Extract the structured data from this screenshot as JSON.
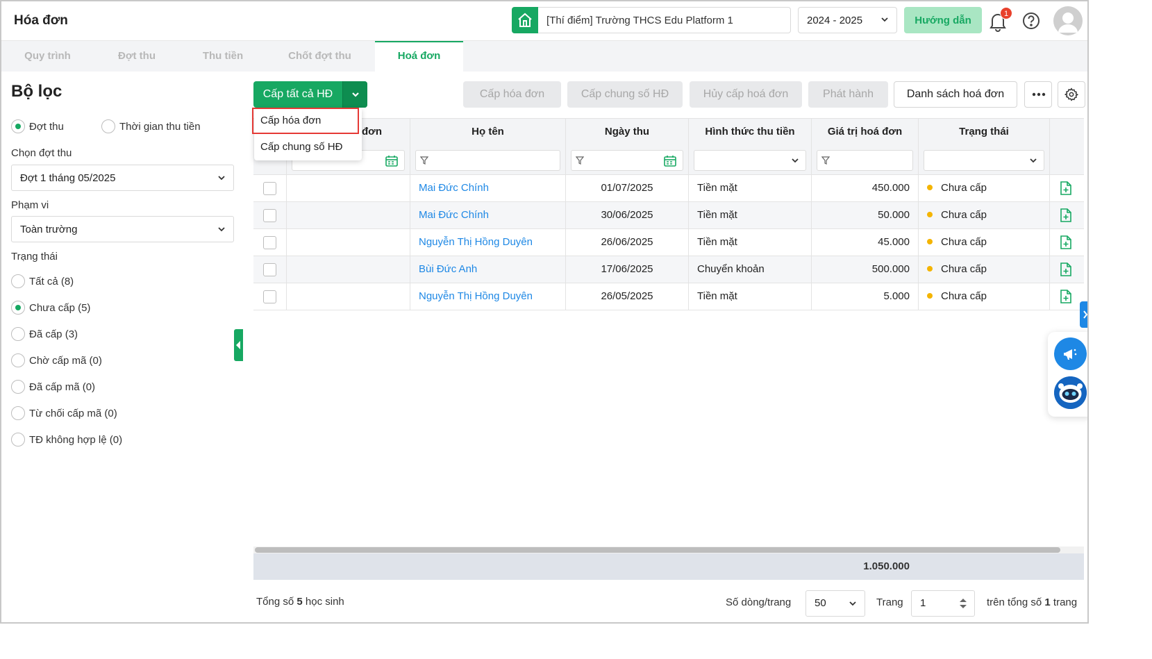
{
  "header": {
    "title": "Hóa đơn",
    "school": "[Thí điểm] Trường THCS Edu Platform 1",
    "school_year": "2024 - 2025",
    "guide_label": "Hướng dẫn",
    "notification_count": "1"
  },
  "tabs": [
    {
      "label": "Quy trình"
    },
    {
      "label": "Đợt thu"
    },
    {
      "label": "Thu tiền"
    },
    {
      "label": "Chốt đợt thu"
    },
    {
      "label": "Hoá đơn"
    }
  ],
  "filter": {
    "title": "Bộ lọc",
    "mode_options": [
      "Đợt thu",
      "Thời gian thu tiền"
    ],
    "period_label": "Chọn đợt thu",
    "period_value": "Đợt 1 tháng 05/2025",
    "scope_label": "Phạm vi",
    "scope_value": "Toàn trường",
    "status_label": "Trạng thái",
    "status_options": [
      "Tất cả (8)",
      "Chưa cấp (5)",
      "Đã cấp (3)",
      "Chờ cấp mã (0)",
      "Đã cấp mã (0)",
      "Từ chối cấp mã (0)",
      "TĐ không hợp lệ (0)"
    ]
  },
  "toolbar": {
    "issue_all": "Cấp tất cả HĐ",
    "issue_invoice": "Cấp hóa đơn",
    "issue_common_number": "Cấp chung số HĐ",
    "cancel_issue": "Hủy cấp hoá đơn",
    "publish": "Phát hành",
    "invoice_list": "Danh sách hoá đơn"
  },
  "dropdown_menu": {
    "items": [
      "Cấp hóa đơn",
      "Cấp chung số HĐ"
    ]
  },
  "table": {
    "columns": [
      "đơn",
      "Họ tên",
      "Ngày thu",
      "Hình thức thu tiền",
      "Giá trị hoá đơn",
      "Trạng thái"
    ],
    "rows": [
      {
        "name": "Mai Đức Chính",
        "date": "01/07/2025",
        "method": "Tiền mặt",
        "amount": "450.000",
        "status": "Chưa cấp"
      },
      {
        "name": "Mai Đức Chính",
        "date": "30/06/2025",
        "method": "Tiền mặt",
        "amount": "50.000",
        "status": "Chưa cấp"
      },
      {
        "name": "Nguyễn Thị Hồng Duyên",
        "date": "26/06/2025",
        "method": "Tiền mặt",
        "amount": "45.000",
        "status": "Chưa cấp"
      },
      {
        "name": "Bùi Đức Anh",
        "date": "17/06/2025",
        "method": "Chuyển khoản",
        "amount": "500.000",
        "status": "Chưa cấp"
      },
      {
        "name": "Nguyễn Thị Hồng Duyên",
        "date": "26/05/2025",
        "method": "Tiền mặt",
        "amount": "5.000",
        "status": "Chưa cấp"
      }
    ],
    "total_amount": "1.050.000"
  },
  "footer": {
    "total_prefix": "Tổng số",
    "total_count": "5",
    "total_suffix": "học sinh",
    "rows_per_page_label": "Số dòng/trang",
    "rows_per_page": "50",
    "page_label": "Trang",
    "page": "1",
    "of_total_prefix": "trên tổng số",
    "of_total_pages": "1",
    "of_total_suffix": "trang"
  },
  "colors": {
    "brand_green": "#17a862",
    "link_blue": "#1e88e5",
    "status_yellow": "#f4b400",
    "highlight_red": "#e53935"
  }
}
